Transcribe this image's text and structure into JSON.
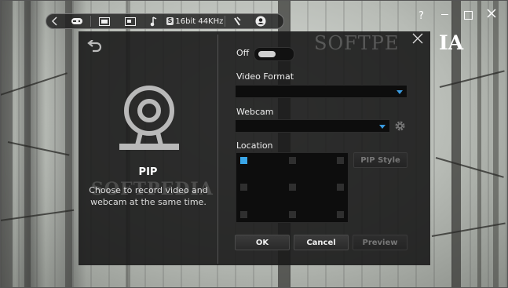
{
  "toolbar": {
    "audio_badge": "S",
    "audio_label": "16bit 44KHz",
    "icons": [
      "back-arrow-icon",
      "gamepad-icon",
      "fullscreen-icon",
      "window-icon",
      "music-note-icon",
      "speaker-icon",
      "microphone-icon",
      "user-icon"
    ]
  },
  "window": {
    "help_label": "?",
    "watermark_top": "SOFTPE",
    "watermark_ia": "IA"
  },
  "pip": {
    "title": "PIP",
    "description": "Choose to record video and webcam at the same time.",
    "watermark": "SOFTPEDIA"
  },
  "form": {
    "toggle_label": "Off",
    "video_format_label": "Video Format",
    "video_format_value": "",
    "webcam_label": "Webcam",
    "webcam_value": "",
    "location_label": "Location",
    "pip_style_label": "PIP Style",
    "location_selected": "top-left"
  },
  "buttons": {
    "ok": "OK",
    "cancel": "Cancel",
    "preview": "Preview"
  },
  "colors": {
    "accent": "#3aa6e8",
    "panel": "#1a1a1a"
  }
}
